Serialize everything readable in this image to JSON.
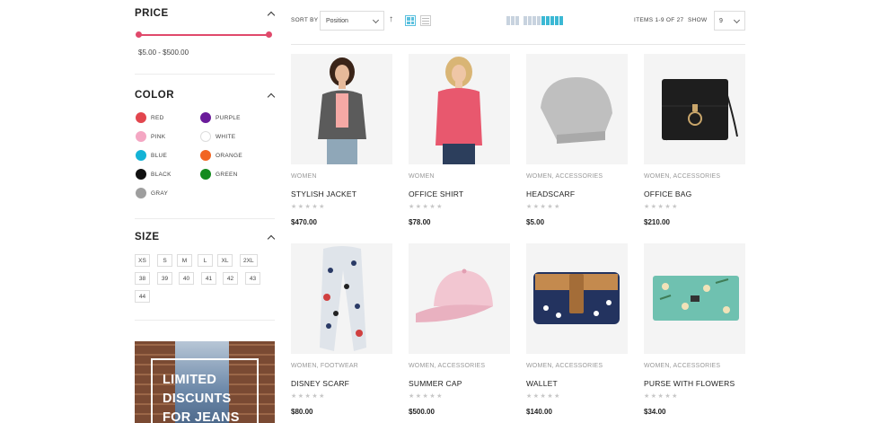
{
  "filters": {
    "price": {
      "title": "PRICE",
      "range": "$5.00 - $500.00"
    },
    "color": {
      "title": "COLOR",
      "items": [
        {
          "label": "RED",
          "hex": "#e2464e"
        },
        {
          "label": "PURPLE",
          "hex": "#6a1b9a"
        },
        {
          "label": "PINK",
          "hex": "#f4a7c3"
        },
        {
          "label": "WHITE",
          "hex": "#ffffff"
        },
        {
          "label": "BLUE",
          "hex": "#14b3d6"
        },
        {
          "label": "ORANGE",
          "hex": "#f26522"
        },
        {
          "label": "BLACK",
          "hex": "#111111"
        },
        {
          "label": "GREEN",
          "hex": "#138a1e"
        },
        {
          "label": "GRAY",
          "hex": "#9e9e9e"
        }
      ]
    },
    "size": {
      "title": "SIZE",
      "items": [
        "XS",
        "S",
        "M",
        "L",
        "XL",
        "2XL",
        "38",
        "39",
        "40",
        "41",
        "42",
        "43",
        "44"
      ]
    }
  },
  "banner": {
    "text": "LIMITED\nDISCUNTS\nFOR JEANS"
  },
  "toolbar": {
    "sort_label": "SORT BY",
    "sort_value": "Position",
    "items_count": "ITEMS 1-9 OF 27",
    "show_label": "SHOW",
    "show_value": "9"
  },
  "products": [
    {
      "category": "WOMEN",
      "name": "STYLISH JACKET",
      "price": "$470.00",
      "rating": "★★★★★"
    },
    {
      "category": "WOMEN",
      "name": "OFFICE SHIRT",
      "price": "$78.00",
      "rating": "★★★★★"
    },
    {
      "category": "WOMEN, ACCESSORIES",
      "name": "HEADSCARF",
      "price": "$5.00",
      "rating": "★★★★★"
    },
    {
      "category": "WOMEN, ACCESSORIES",
      "name": "OFFICE BAG",
      "price": "$210.00",
      "rating": "★★★★★"
    },
    {
      "category": "WOMEN, FOOTWEAR",
      "name": "DISNEY SCARF",
      "price": "$80.00",
      "rating": "★★★★★"
    },
    {
      "category": "WOMEN, ACCESSORIES",
      "name": "SUMMER CAP",
      "price": "$500.00",
      "rating": "★★★★★"
    },
    {
      "category": "WOMEN, ACCESSORIES",
      "name": "WALLET",
      "price": "$140.00",
      "rating": "★★★★★"
    },
    {
      "category": "WOMEN, ACCESSORIES",
      "name": "PURSE WITH FLOWERS",
      "price": "$34.00",
      "rating": "★★★★★"
    }
  ]
}
